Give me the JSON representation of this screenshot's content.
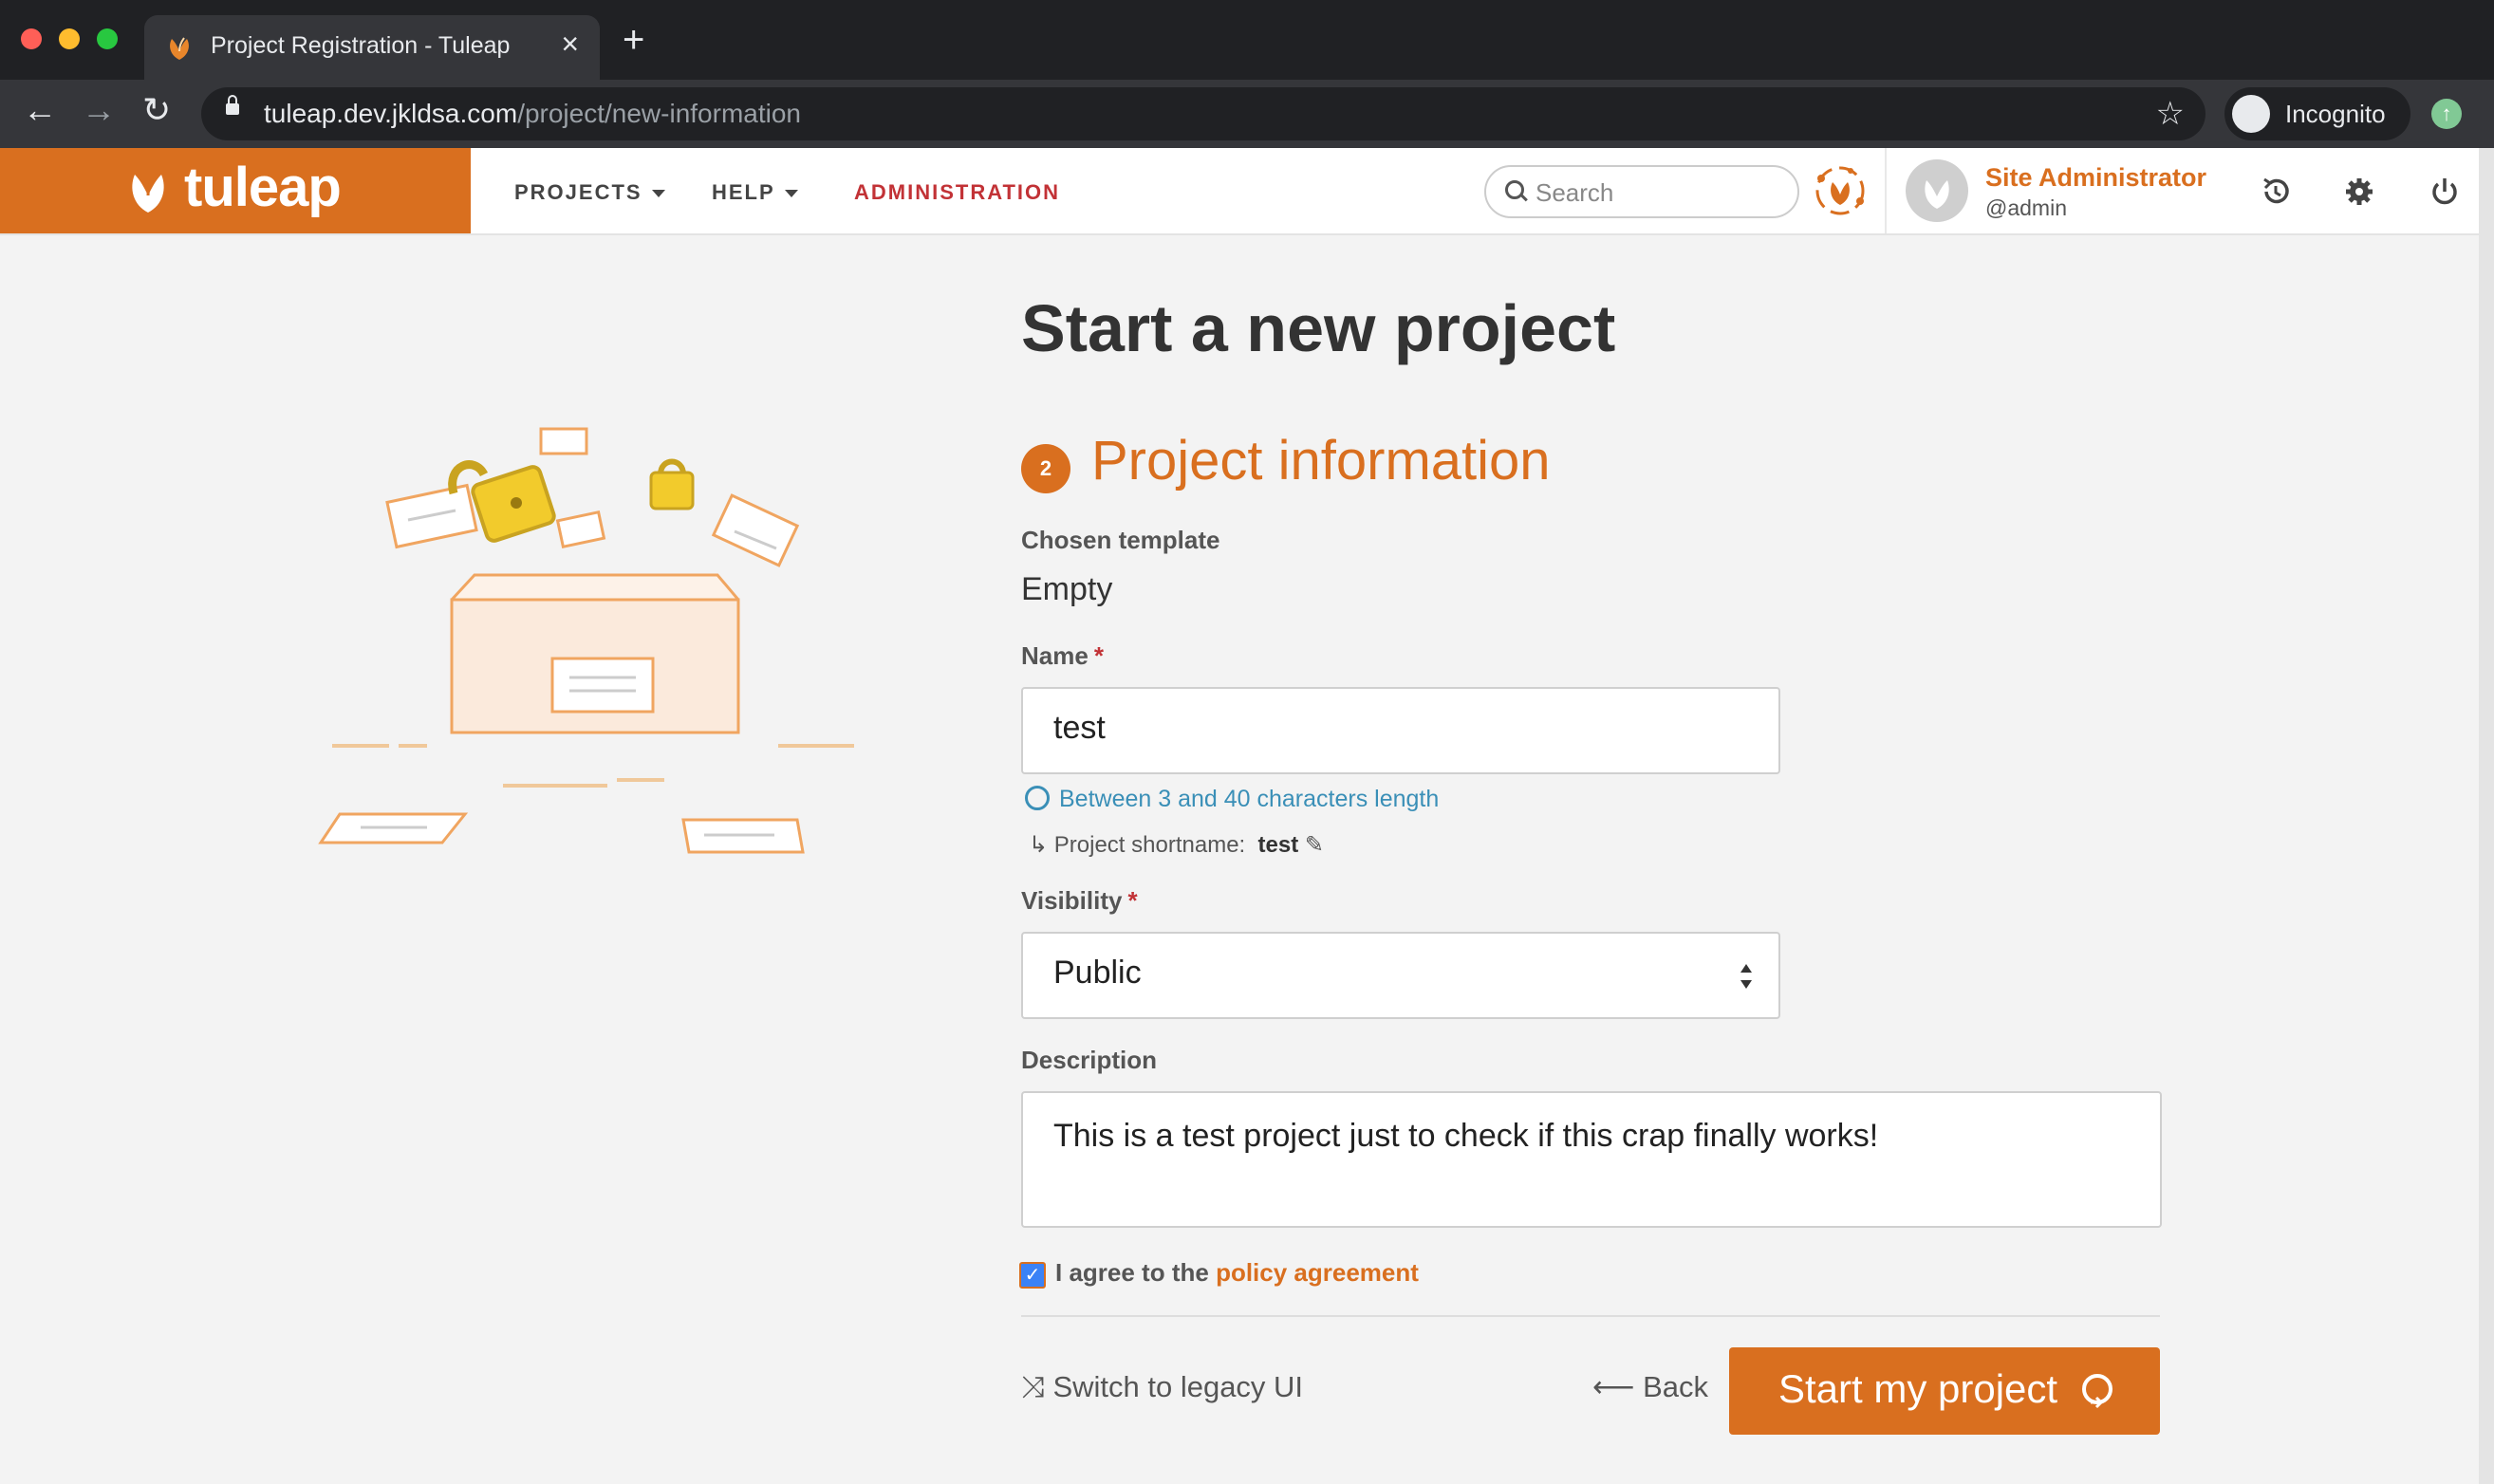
{
  "browser": {
    "tab_title": "Project Registration - Tuleap",
    "url_host": "tuleap.dev.jkldsa.com",
    "url_path": "/project/new-information",
    "profile_label": "Incognito"
  },
  "app": {
    "logo_text": "tuleap",
    "nav": {
      "projects": "PROJECTS",
      "help": "HELP",
      "administration": "ADMINISTRATION"
    },
    "search_placeholder": "Search",
    "user": {
      "name": "Site Administrator",
      "login": "@admin"
    }
  },
  "page": {
    "title": "Start a new project",
    "step_number": "2",
    "step_title": "Project information",
    "template_label": "Chosen template",
    "template_value": "Empty",
    "name_label": "Name",
    "name_value": "test",
    "name_hint": "Between 3 and 40 characters length",
    "shortname_label": "Project shortname:",
    "shortname_value": "test",
    "visibility_label": "Visibility",
    "visibility_value": "Public",
    "description_label": "Description",
    "description_value": "This is a test project just to check if this crap finally works!",
    "agree_text": "I agree to the",
    "policy_link": "policy agreement",
    "agree_checked": true,
    "legacy_link": "Switch to legacy UI",
    "back_link": "Back",
    "submit_button": "Start my project"
  },
  "colors": {
    "brand": "#d96f1f",
    "admin": "#c23236",
    "hint": "#3a8fb7"
  },
  "required_marker": "*",
  "icons": [
    "tuleap-logo-icon",
    "search-icon",
    "bot-icon",
    "avatar",
    "history-icon",
    "settings-icon",
    "logout-icon",
    "help-circle-icon",
    "arrow-return-icon",
    "pencil-icon",
    "shuffle-icon",
    "arrow-left-icon",
    "arrow-circle-right-icon",
    "star-icon",
    "lock-icon",
    "incognito-icon"
  ]
}
